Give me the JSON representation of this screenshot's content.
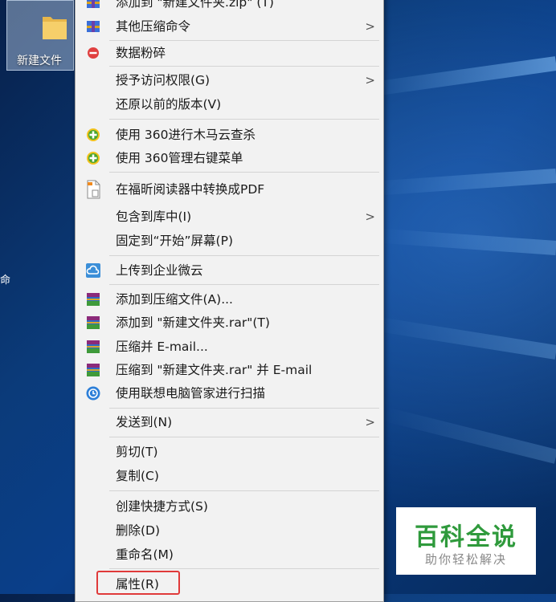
{
  "desktop": {
    "folder_label": "新建文件",
    "edge_chars": [
      "命"
    ]
  },
  "context_menu": {
    "items": [
      {
        "id": "add-zip",
        "label": "添加到 \"新建文件夹.zip\" (T)",
        "icon": "winrar-zip-icon"
      },
      {
        "id": "other-compress",
        "label": "其他压缩命令",
        "icon": "winrar-zip-icon",
        "submenu": true
      },
      {
        "id": "shred",
        "label": "数据粉碎",
        "icon": "shred-icon"
      },
      {
        "id": "grant-access",
        "label": "授予访问权限(G)",
        "submenu": true
      },
      {
        "id": "restore-versions",
        "label": "还原以前的版本(V)"
      },
      {
        "id": "scan-360",
        "label": "使用 360进行木马云查杀",
        "icon": "360-icon"
      },
      {
        "id": "manage-360",
        "label": "使用 360管理右键菜单",
        "icon": "360-icon"
      },
      {
        "id": "foxit-pdf",
        "label": "在福昕阅读器中转换成PDF",
        "icon": "pdf-document-icon"
      },
      {
        "id": "include-library",
        "label": "包含到库中(I)",
        "submenu": true
      },
      {
        "id": "pin-start",
        "label": "固定到“开始”屏幕(P)"
      },
      {
        "id": "upload-weiyun",
        "label": "上传到企业微云",
        "icon": "cloud-upload-icon"
      },
      {
        "id": "add-archive",
        "label": "添加到压缩文件(A)...",
        "icon": "winrar-icon"
      },
      {
        "id": "add-rar",
        "label": "添加到 \"新建文件夹.rar\"(T)",
        "icon": "winrar-icon"
      },
      {
        "id": "compress-email",
        "label": "压缩并 E-mail...",
        "icon": "winrar-icon"
      },
      {
        "id": "compress-rar-email",
        "label": "压缩到 \"新建文件夹.rar\" 并 E-mail",
        "icon": "winrar-icon"
      },
      {
        "id": "lenovo-scan",
        "label": "使用联想电脑管家进行扫描",
        "icon": "lenovo-icon"
      },
      {
        "id": "send-to",
        "label": "发送到(N)",
        "submenu": true
      },
      {
        "id": "cut",
        "label": "剪切(T)"
      },
      {
        "id": "copy",
        "label": "复制(C)"
      },
      {
        "id": "create-shortcut",
        "label": "创建快捷方式(S)"
      },
      {
        "id": "delete",
        "label": "删除(D)"
      },
      {
        "id": "rename",
        "label": "重命名(M)"
      },
      {
        "id": "properties",
        "label": "属性(R)"
      }
    ],
    "submenu_arrow": ">"
  },
  "watermark": {
    "title": "百科全说",
    "subtitle": "助你轻松解决"
  },
  "colors": {
    "highlight_border": "#e03a3a",
    "watermark_green": "#2f9a3c"
  }
}
